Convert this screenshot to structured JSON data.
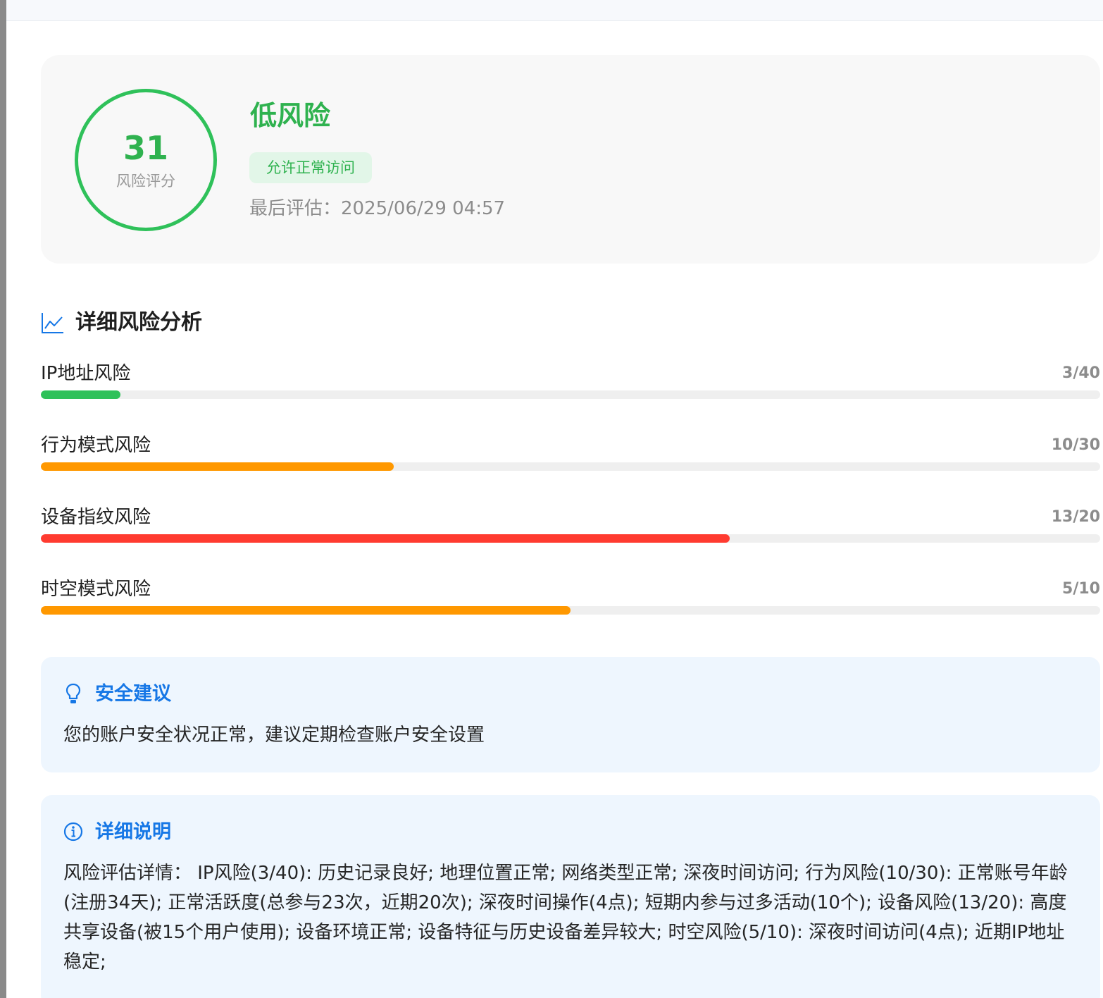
{
  "summary": {
    "score": "31",
    "score_label": "风险评分",
    "level": "低风险",
    "access_badge": "允许正常访问",
    "last_eval": "最后评估：2025/06/29 04:57",
    "accent_color": "#2fc15a"
  },
  "analysis": {
    "title": "详细风险分析",
    "icon": "line-chart-icon",
    "items": [
      {
        "name": "IP地址风险",
        "score_text": "3/40",
        "score": 3,
        "max": 40,
        "color": "#2fc15a"
      },
      {
        "name": "行为模式风险",
        "score_text": "10/30",
        "score": 10,
        "max": 30,
        "color": "#ff9800"
      },
      {
        "name": "设备指纹风险",
        "score_text": "13/20",
        "score": 13,
        "max": 20,
        "color": "#ff3b30"
      },
      {
        "name": "时空模式风险",
        "score_text": "5/10",
        "score": 5,
        "max": 10,
        "color": "#ff9800"
      }
    ]
  },
  "advice": {
    "icon": "lightbulb-icon",
    "title": "安全建议",
    "body": "您的账户安全状况正常，建议定期检查账户安全设置"
  },
  "details": {
    "icon": "info-circle-icon",
    "title": "详细说明",
    "body": "风险评估详情： IP风险(3/40): 历史记录良好; 地理位置正常; 网络类型正常; 深夜时间访问; 行为风险(10/30): 正常账号年龄(注册34天); 正常活跃度(总参与23次，近期20次); 深夜时间操作(4点); 短期内参与过多活动(10个); 设备风险(13/20): 高度共享设备(被15个用户使用); 设备环境正常; 设备特征与历史设备差异较大; 时空风险(5/10): 深夜时间访问(4点); 近期IP地址稳定;"
  },
  "colors": {
    "accent_blue": "#1677e6",
    "card_blue_bg": "#eef6fe"
  }
}
